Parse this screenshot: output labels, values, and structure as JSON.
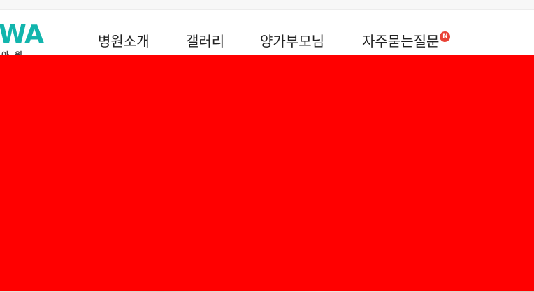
{
  "logo": {
    "mark": "WA",
    "sub": "아원"
  },
  "nav": {
    "items": [
      {
        "label": "병원소개",
        "active": false,
        "new": false
      },
      {
        "label": "갤러리",
        "active": true,
        "new": false
      },
      {
        "label": "양가부모님",
        "active": false,
        "new": false
      },
      {
        "label": "자주묻는질문",
        "active": false,
        "new": true
      }
    ],
    "new_badge": "N"
  },
  "colors": {
    "accent": "#12b5ad",
    "badge": "#e94235",
    "hero": "#ff0000",
    "text": "#222222"
  }
}
